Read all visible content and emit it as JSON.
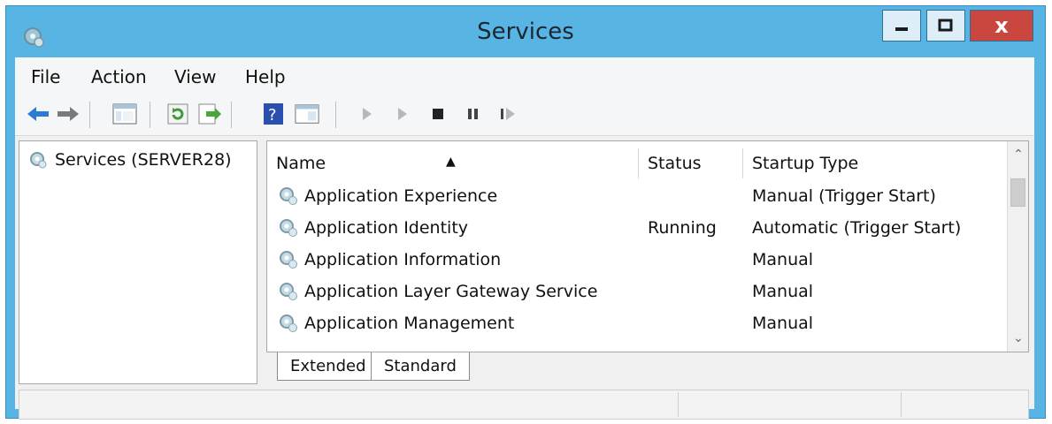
{
  "window": {
    "title": "Services",
    "close_glyph": "x"
  },
  "menu": [
    "File",
    "Action",
    "View",
    "Help"
  ],
  "toolbar": {
    "icons": [
      "back-icon",
      "forward-icon",
      "show-hide-console-tree-icon",
      "refresh-icon",
      "export-list-icon",
      "help-icon",
      "properties-icon",
      "start-service-icon",
      "start-service-alt-icon",
      "stop-service-icon",
      "pause-service-icon",
      "resume-service-icon"
    ]
  },
  "tree": {
    "root_label": "Services (SERVER28)"
  },
  "table": {
    "columns": [
      "Name",
      "Status",
      "Startup Type"
    ],
    "rows": [
      {
        "name": "Application Experience",
        "status": "",
        "startup": "Manual (Trigger Start)"
      },
      {
        "name": "Application Identity",
        "status": "Running",
        "startup": "Automatic (Trigger Start)"
      },
      {
        "name": "Application Information",
        "status": "",
        "startup": "Manual"
      },
      {
        "name": "Application Layer Gateway Service",
        "status": "",
        "startup": "Manual"
      },
      {
        "name": "Application Management",
        "status": "",
        "startup": "Manual"
      }
    ]
  },
  "tabs": [
    "Extended",
    "Standard"
  ],
  "colors": {
    "title_bar": "#57b4e3",
    "close_button": "#c9473e",
    "accent_blue": "#2a7ad6"
  }
}
